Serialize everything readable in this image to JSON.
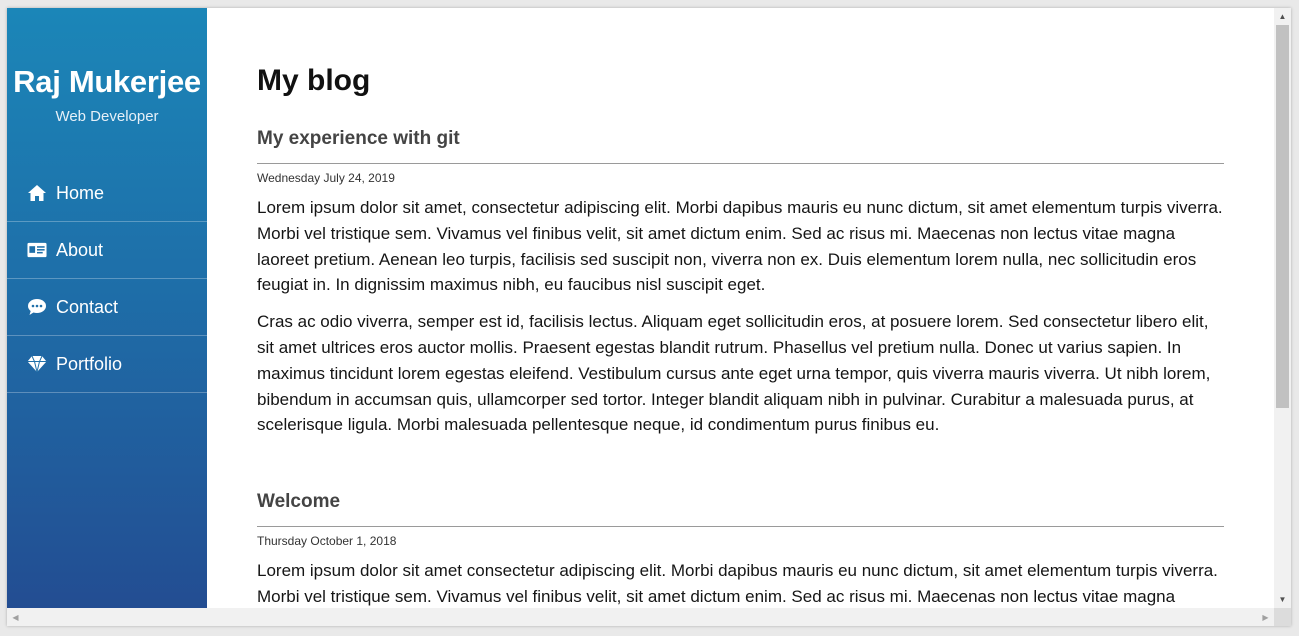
{
  "sidebar": {
    "name": "Raj Mukerjee",
    "role": "Web Developer",
    "items": [
      {
        "label": "Home",
        "icon": "home-icon"
      },
      {
        "label": "About",
        "icon": "id-card-icon"
      },
      {
        "label": "Contact",
        "icon": "chat-bubble-icon"
      },
      {
        "label": "Portfolio",
        "icon": "diamond-icon"
      }
    ]
  },
  "main": {
    "title": "My blog",
    "posts": [
      {
        "title": "My experience with git",
        "date": "Wednesday July 24, 2019",
        "paragraphs": [
          "Lorem ipsum dolor sit amet, consectetur adipiscing elit. Morbi dapibus mauris eu nunc dictum, sit amet elementum turpis viverra. Morbi vel tristique sem. Vivamus vel finibus velit, sit amet dictum enim. Sed ac risus mi. Maecenas non lectus vitae magna laoreet pretium. Aenean leo turpis, facilisis sed suscipit non, viverra non ex. Duis elementum lorem nulla, nec sollicitudin eros feugiat in. In dignissim maximus nibh, eu faucibus nisl suscipit eget.",
          "Cras ac odio viverra, semper est id, facilisis lectus. Aliquam eget sollicitudin eros, at posuere lorem. Sed consectetur libero elit, sit amet ultrices eros auctor mollis. Praesent egestas blandit rutrum. Phasellus vel pretium nulla. Donec ut varius sapien. In maximus tincidunt lorem egestas eleifend. Vestibulum cursus ante eget urna tempor, quis viverra mauris viverra. Ut nibh lorem, bibendum in accumsan quis, ullamcorper sed tortor. Integer blandit aliquam nibh in pulvinar. Curabitur a malesuada purus, at scelerisque ligula. Morbi malesuada pellentesque neque, id condimentum purus finibus eu."
        ]
      },
      {
        "title": "Welcome",
        "date": "Thursday October 1, 2018",
        "paragraphs": [
          "Lorem ipsum dolor sit amet consectetur adipiscing elit. Morbi dapibus mauris eu nunc dictum, sit amet elementum turpis viverra. Morbi vel tristique sem. Vivamus vel finibus velit, sit amet dictum enim. Sed ac risus mi. Maecenas non lectus vitae magna laoreet pretium."
        ]
      }
    ]
  },
  "colors": {
    "sidebar_top": "#1b86b8",
    "sidebar_bottom": "#234d92",
    "text": "#151515"
  },
  "scrollbars": {
    "vertical_icons": [
      "scroll-up-icon",
      "scroll-down-icon"
    ],
    "horizontal_icons": [
      "scroll-left-icon",
      "scroll-right-icon"
    ]
  }
}
